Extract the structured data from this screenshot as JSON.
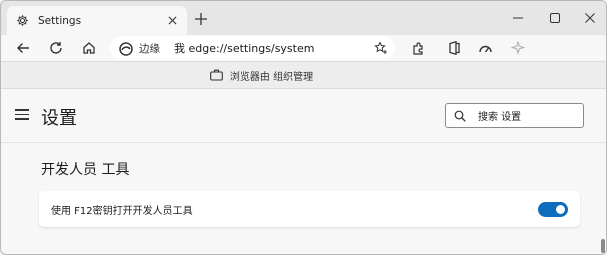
{
  "tab": {
    "title": "Settings",
    "icon": "gear-icon"
  },
  "window_controls": {
    "minimize": "minimize-icon",
    "maximize": "maximize-icon",
    "close": "close-icon"
  },
  "address_bar": {
    "site_label": "边缘",
    "prefix": "我",
    "url": "edge://settings/system"
  },
  "managed_bar": {
    "text": "浏览器由 组织管理"
  },
  "settings": {
    "title": "设置",
    "search_placeholder": "搜索 设置"
  },
  "section": {
    "title": "开发人员 工具"
  },
  "setting_row": {
    "label": "使用 F12密钥打开开发人员工具",
    "enabled": true
  },
  "colors": {
    "accent": "#0f6cbd",
    "tabstrip": "#e6e6e6",
    "page": "#f7f7f7"
  }
}
